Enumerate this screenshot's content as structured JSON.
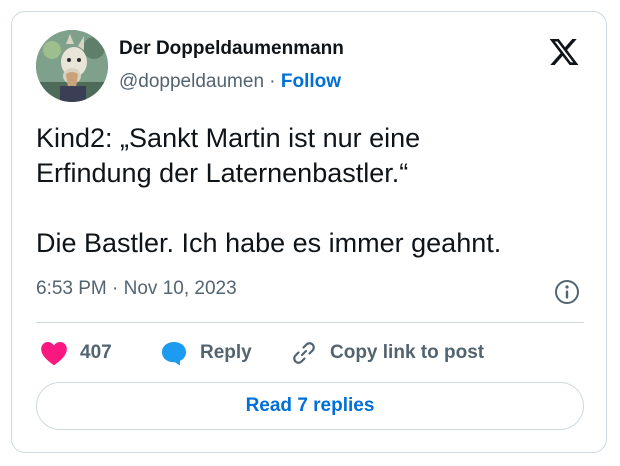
{
  "author": {
    "display_name": "Der Doppeldaumenmann",
    "handle": "@doppeldaumen",
    "separator": "·",
    "follow_label": "Follow"
  },
  "tweet": {
    "text": "Kind2: „Sankt Martin ist nur eine\nErfindung der Laternenbastler.“\n\nDie Bastler. Ich habe es immer geahnt.",
    "timestamp": "6:53 PM · Nov 10, 2023"
  },
  "actions": {
    "like_count": "407",
    "reply_label": "Reply",
    "copy_link_label": "Copy link to post"
  },
  "read_replies_label": "Read 7 replies",
  "icons": {
    "brand": "x-logo-icon",
    "info": "info-icon",
    "like": "heart-icon",
    "reply": "speech-bubble-icon",
    "copy": "link-icon"
  },
  "colors": {
    "accent": "#006fd6",
    "heart": "#f91880",
    "reply_bubble": "#1d9bf0",
    "muted_text": "#536471",
    "border": "#cfd9de"
  }
}
